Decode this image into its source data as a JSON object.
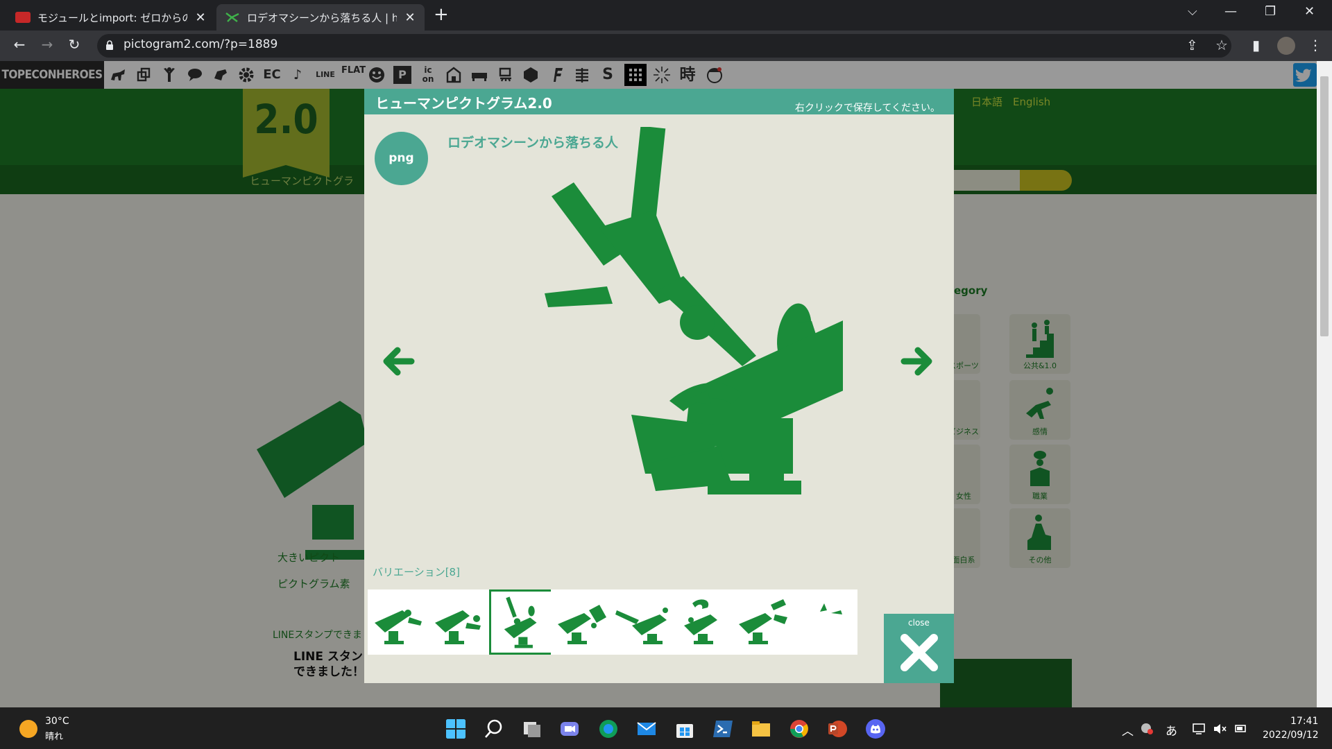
{
  "browser": {
    "tabs": [
      {
        "title": "モジュールとimport: ゼロからのPython",
        "close": "✕"
      },
      {
        "title": "ロデオマシーンから落ちる人 | human p",
        "close": "✕"
      }
    ],
    "new_tab": "+",
    "window_controls": [
      "⌵",
      "—",
      "❐",
      "✕"
    ],
    "url": "pictogram2.com/?p=1889",
    "nav": {
      "back": "←",
      "forward": "→",
      "reload": "↻"
    },
    "right_icons": {
      "share": "⇪",
      "bookmark": "☆",
      "sidepanel": "▮",
      "menu": "⋮"
    }
  },
  "site": {
    "brand": "TOPECONHEROES",
    "nav_glyphs": [
      "EC",
      "♪",
      "LINE",
      "FLAT",
      "P",
      "ic on",
      "S",
      "時"
    ],
    "badge": "2.0",
    "lang": "日本語　English",
    "breadcrumb": "ヒューマンピクトグラ",
    "category_label": "egory",
    "categories": [
      {
        "label": "スポーツ"
      },
      {
        "label": "公共&1.0"
      },
      {
        "label": "ビジネス"
      },
      {
        "label": "感情"
      },
      {
        "label": "女性"
      },
      {
        "label": "職業"
      },
      {
        "label": "面白系"
      },
      {
        "label": "その他"
      }
    ],
    "side_links": [
      "大きいピクト",
      "ピクトグラム素"
    ],
    "line_label": "LINEスタンプできま",
    "line_banner": "LINE スタン できました！"
  },
  "modal": {
    "title": "ヒューマンピクトグラム2.0",
    "hint": "右クリックで保存してください。",
    "png_button": "png",
    "picto_name": "ロデオマシーンから落ちる人",
    "variation_label": "バリエーション[8]",
    "close_label": "close",
    "colors": {
      "picto": "#1b8c3a",
      "accent": "#4ba792"
    }
  },
  "taskbar": {
    "temp": "30°C",
    "condition": "晴れ",
    "time": "17:41",
    "date": "2022/09/12",
    "ime": "あ"
  }
}
